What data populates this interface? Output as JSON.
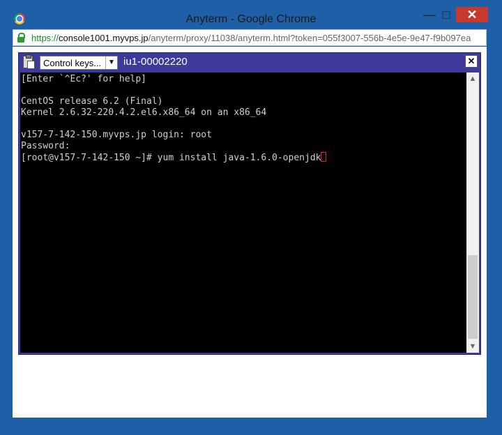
{
  "window": {
    "title": "Anyterm - Google Chrome",
    "controls": {
      "minimize": "—",
      "maximize": "□",
      "close": "✕"
    }
  },
  "address_bar": {
    "scheme": "https://",
    "host": "console1001.myvps.jp",
    "path": "/anyterm/proxy/11038/anyterm.html?token=055f3007-556b-4e5e-9e47-f9b097ea"
  },
  "terminal_header": {
    "control_keys_label": "Control keys...",
    "session_id": "iu1-00002220",
    "close_label": "✕"
  },
  "terminal": {
    "lines": [
      "[Enter `^Ec?' for help]",
      "",
      "CentOS release 6.2 (Final)",
      "Kernel 2.6.32-220.4.2.el6.x86_64 on an x86_64",
      "",
      "v157-7-142-150.myvps.jp login: root",
      "Password:",
      "[root@v157-7-142-150 ~]# yum install java-1.6.0-openjdk"
    ]
  },
  "icons": {
    "browser": "chrome-icon",
    "secure": "lock-icon",
    "clipboard": "clipboard-icon",
    "dropdown": "chevron-down-icon"
  }
}
